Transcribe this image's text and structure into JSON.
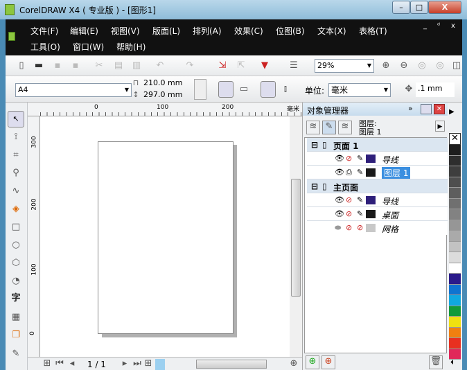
{
  "window": {
    "title": "CorelDRAW X4 ( 专业版 ) - [图形1]",
    "minimize": "–",
    "restore": "□",
    "close": "X"
  },
  "menu": {
    "row1": [
      "文件(F)",
      "编辑(E)",
      "视图(V)",
      "版面(L)",
      "排列(A)",
      "效果(C)",
      "位图(B)",
      "文本(X)",
      "表格(T)"
    ],
    "row2": [
      "工具(O)",
      "窗口(W)",
      "帮助(H)"
    ],
    "doc_controls": [
      "_",
      "ᵈ",
      "x"
    ]
  },
  "toolbar": {
    "zoom": "29%"
  },
  "property_bar": {
    "paper": "A4",
    "width": "210.0 mm",
    "height": "297.0 mm",
    "unit_label": "单位:",
    "unit": "毫米",
    "nudge": ".1 mm"
  },
  "ruler": {
    "h_ticks": [
      "0",
      "100",
      "200"
    ],
    "h_unit": "毫米",
    "v_ticks": [
      "300",
      "200",
      "100",
      "0"
    ]
  },
  "status": {
    "page": "1 / 1"
  },
  "docker": {
    "title": "对象管理器",
    "layer_label": "图层:",
    "layer_value": "图层 1",
    "tree": [
      {
        "type": "page",
        "label": "页面 1"
      },
      {
        "type": "layer",
        "label": "导线",
        "color": "#2e1f7a",
        "printable": false
      },
      {
        "type": "layer",
        "label": "图层 1",
        "color": "#1a1a1a",
        "printable": true,
        "selected": true
      },
      {
        "type": "page",
        "label": "主页面"
      },
      {
        "type": "layer",
        "label": "导线",
        "color": "#2e1f7a",
        "printable": false
      },
      {
        "type": "layer",
        "label": "桌面",
        "color": "#1a1a1a",
        "printable": false
      },
      {
        "type": "layer",
        "label": "网格",
        "color": "#c8c8c8",
        "printable": false
      }
    ]
  },
  "palette": [
    "#1e1e1e",
    "#2e2e2e",
    "#3e3e3e",
    "#4e4e4e",
    "#5e5e5e",
    "#707070",
    "#828282",
    "#969696",
    "#aaaaaa",
    "#c2c2c2",
    "#dcdcdc",
    "#ffffff",
    "#2a1a8a",
    "#0f74d0",
    "#10a8e0",
    "#129a3a",
    "#f0e010",
    "#f08010",
    "#e83020",
    "#e0285a"
  ],
  "toolbox_text_tool": "字"
}
